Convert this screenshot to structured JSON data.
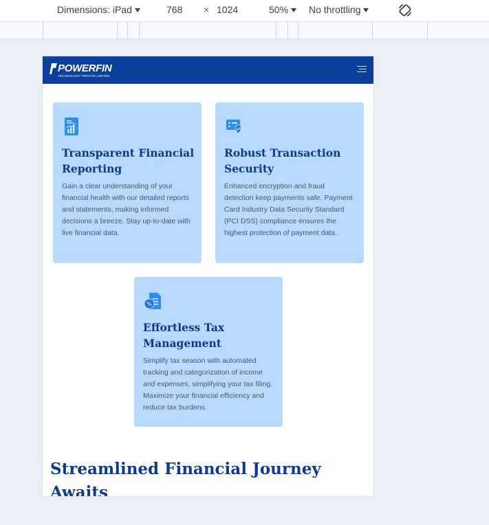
{
  "devtools": {
    "dimensions_label": "Dimensions: iPad",
    "width": "768",
    "times": "×",
    "height": "1024",
    "zoom": "50%",
    "throttling": "No throttling"
  },
  "site": {
    "logo_name": "POWERFIN",
    "logo_sub": "TECHNOLOGY PRIVATE LIMITED",
    "cards": [
      {
        "icon": "report-icon",
        "title": "Transparent Financial Reporting",
        "body": "Gain a clear understanding of your financial health with our detailed reports and statements, making informed decisions a breeze. Stay up-to-date with live financial data."
      },
      {
        "icon": "secure-card-icon",
        "title": "Robust Transaction Security",
        "body": "Enhanced encryption and fraud detection keep payments safe. Payment Card Industry Data Security Standard (PCI DSS) compliance ensures the highest protection of payment data."
      },
      {
        "icon": "tax-document-icon",
        "title": "Effortless Tax Management",
        "body": "Simplify tax season with automated tracking and categorization of income and expenses, simplifying your tax filing. Maximize your financial efficiency and reduce tax burdens."
      }
    ],
    "section_title": "Streamlined Financial Journey Awaits"
  }
}
